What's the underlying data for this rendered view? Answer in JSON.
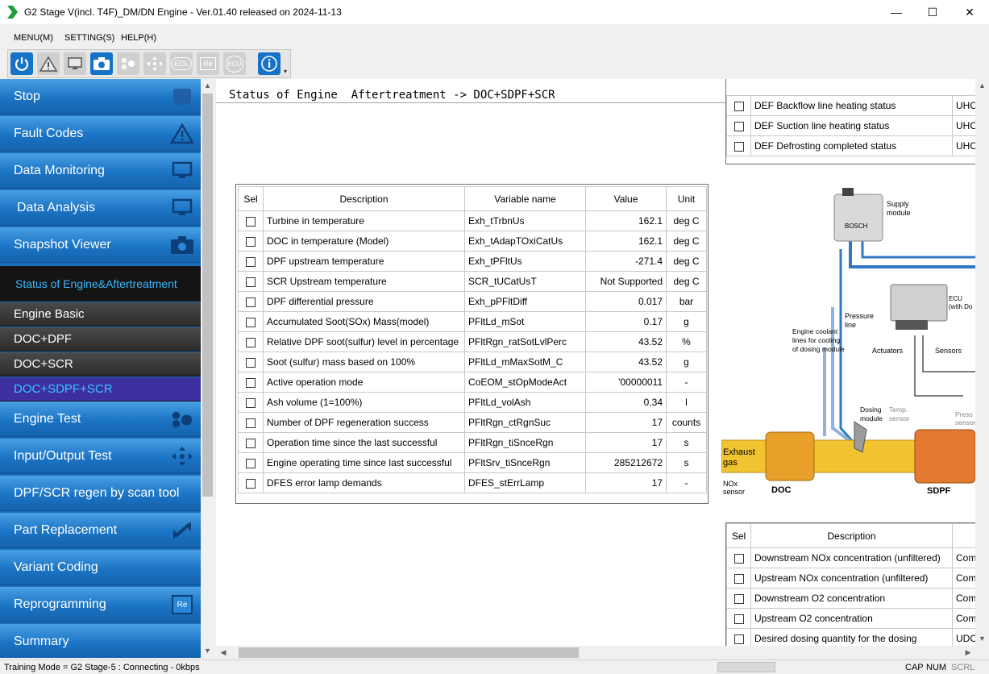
{
  "window": {
    "title": "G2 Stage V(incl. T4F)_DM/DN Engine - Ver.01.40 released on 2024-11-13",
    "min_glyph": "—",
    "max_glyph": "☐",
    "close_glyph": "✕"
  },
  "menu": [
    "MENU(M)",
    "SETTING(S)",
    "HELP(H)"
  ],
  "toolbar": {
    "buttons": [
      "power-icon",
      "warning-icon",
      "monitor-icon",
      "camera-icon",
      "engine-test-icon",
      "io-arrows-icon",
      "eol-icon",
      "re-icon",
      "ecu-icon",
      "info-icon"
    ],
    "eol": "EOL",
    "re": "Re",
    "ecu": "ECU"
  },
  "sidebar": {
    "items": {
      "stop": "Stop",
      "fault_codes": "Fault Codes",
      "data_monitoring": "Data Monitoring",
      "data_analysis": "Data Analysis",
      "snapshot_viewer": "Snapshot Viewer",
      "status_header": "Status of Engine&Aftertreatment",
      "engine_basic": "Engine Basic",
      "doc_dpf": "DOC+DPF",
      "doc_scr": "DOC+SCR",
      "doc_sdpf_scr": "DOC+SDPF+SCR",
      "engine_test": "Engine Test",
      "io_test": "Input/Output Test",
      "regen": "DPF/SCR regen by scan tool",
      "part_replacement": "Part Replacement",
      "variant_coding": "Variant Coding",
      "reprogramming": "Reprogramming",
      "summary": "Summary"
    },
    "re_badge": "Re"
  },
  "content": {
    "header": "Status of Engine  Aftertreatment -> DOC+SDPF+SCR"
  },
  "main_table": {
    "headers": [
      "Sel",
      "Description",
      "Variable name",
      "Value",
      "Unit"
    ],
    "rows": [
      [
        "Turbine in temperature",
        "Exh_tTrbnUs",
        "162.1",
        "deg C"
      ],
      [
        "DOC in temperature (Model)",
        "Exh_tAdapTOxiCatUs",
        "162.1",
        "deg C"
      ],
      [
        "DPF upstream temperature",
        "Exh_tPFltUs",
        "-271.4",
        "deg C"
      ],
      [
        "SCR Upstream temperature",
        "SCR_tUCatUsT",
        "Not Supported",
        "deg C"
      ],
      [
        "DPF differential pressure",
        "Exh_pPFltDiff",
        "0.017",
        "bar"
      ],
      [
        "Accumulated Soot(SOx) Mass(model)",
        "PFltLd_mSot",
        "0.17",
        "g"
      ],
      [
        "Relative DPF soot(sulfur) level in percentage",
        "PFltRgn_ratSotLvlPerc",
        "43.52",
        "%"
      ],
      [
        "Soot (sulfur) mass based on 100%",
        "PFltLd_mMaxSotM_C",
        "43.52",
        "g"
      ],
      [
        "Active operation mode",
        "CoEOM_stOpModeAct",
        "'00000011",
        "-"
      ],
      [
        "Ash volume (1=100%)",
        "PFltLd_volAsh",
        "0.34",
        "l"
      ],
      [
        "Number of DPF regeneration success",
        "PFltRgn_ctRgnSuc",
        "17",
        "counts"
      ],
      [
        "Operation time since the last successful",
        "PFltRgn_tiSnceRgn",
        "17",
        "s"
      ],
      [
        "Engine operating time since last successful",
        "PFltSrv_tiSnceRgn",
        "285212672",
        "s"
      ],
      [
        "DFES error lamp demands",
        "DFES_stErrLamp",
        "17",
        "-"
      ]
    ]
  },
  "top_right_table": {
    "rows": [
      [
        "DEF Backflow line heating status",
        "UHC"
      ],
      [
        "DEF Suction line heating status",
        "UHC"
      ],
      [
        "DEF Defrosting completed status",
        "UHC"
      ]
    ]
  },
  "bottom_right_table": {
    "headers": [
      "Sel",
      "Description"
    ],
    "rows": [
      [
        "Downstream NOx concentration (unfiltered)",
        "Com"
      ],
      [
        "Upstream NOx concentration (unfiltered)",
        "Com"
      ],
      [
        "Downstream O2 concentration",
        "Com"
      ],
      [
        "Upstream O2 concentration",
        "Com"
      ],
      [
        "Desired dosing quantity for the dosing",
        "UDC"
      ]
    ]
  },
  "diagram": {
    "supply_module": "Supply",
    "supply_module2": "module",
    "bosch": "BOSCH",
    "ecu": "ECU",
    "ecu2": "(with Do",
    "pressure_line": "Pressure",
    "pressure_line2": "line",
    "coolant1": "Engine coolant",
    "coolant2": "lines for cooling",
    "coolant3": "of dosing module",
    "actuators": "Actuators",
    "sensors": "Sensors",
    "dosing1": "Dosing",
    "dosing2": "module",
    "temp1": "Temp.",
    "temp2": "sensor",
    "press1": "Press",
    "press2": "sensor",
    "exhaust1": "Exhaust",
    "exhaust2": "gas",
    "nox1": "NOx",
    "nox2": "sensor",
    "doc": "DOC",
    "sdpf": "SDPF"
  },
  "status": {
    "left": "Training Mode = G2 Stage-5 : Connecting - 0kbps",
    "cap": "CAP",
    "num": "NUM",
    "scrl": "SCRL"
  }
}
